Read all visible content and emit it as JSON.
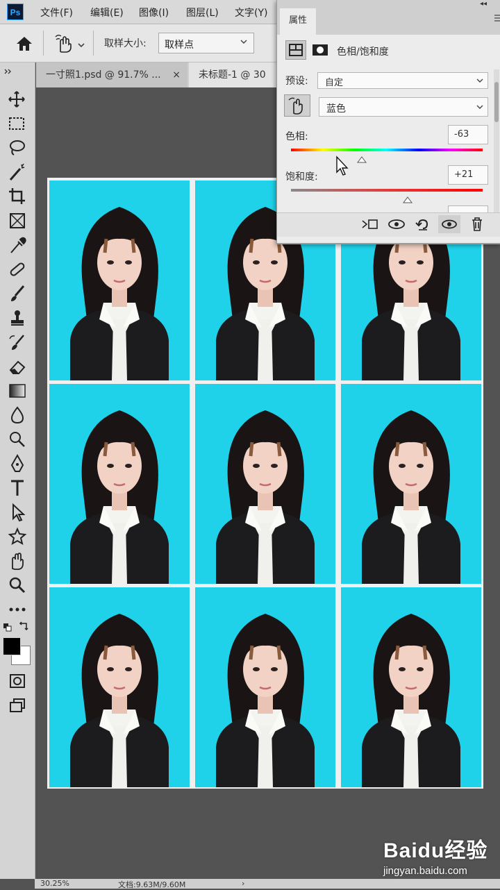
{
  "menubar": {
    "logo": "Ps",
    "items": [
      "文件(F)",
      "编辑(E)",
      "图像(I)",
      "图层(L)",
      "文字(Y)"
    ]
  },
  "options": {
    "sample_size_label": "取样大小:",
    "sample_size_value": "取样点"
  },
  "tabs": [
    {
      "label": "一寸照1.psd @ 91.7% ...",
      "close": "×"
    },
    {
      "label": "未标题-1 @ 30"
    }
  ],
  "properties": {
    "tab_label": "属性",
    "title": "色相/饱和度",
    "preset_label": "预设:",
    "preset_value": "自定",
    "channel_value": "蓝色",
    "hue_label": "色相:",
    "hue_value": "-63",
    "saturation_label": "饱和度:",
    "saturation_value": "+21",
    "hue_slider_fraction": 0.37,
    "saturation_slider_fraction": 0.61
  },
  "status": {
    "zoom": "30.25%",
    "doc": "文档:9.63M/9.60M"
  },
  "watermark": {
    "brand": "Baidu经验",
    "url": "jingyan.baidu.com"
  },
  "colors": {
    "photo_bg": "#1fd2ea",
    "foreground": "#000000",
    "background": "#ffffff"
  }
}
